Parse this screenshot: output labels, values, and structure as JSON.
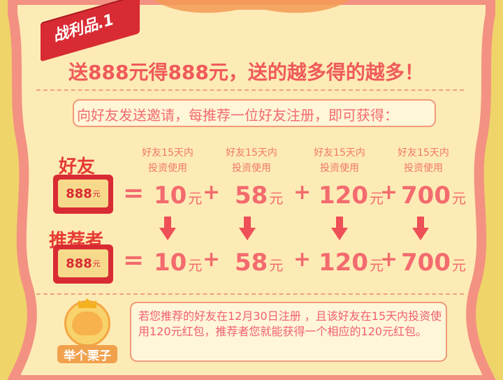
{
  "title_tag": "战利品.1",
  "headline": "送888元得888元，送的越多得的越多！",
  "invite_text": "向好友发送邀请，每推荐一位好友注册，即可获得：",
  "conditions": [
    {
      "line1": "好友15天内",
      "line2": "投资使用"
    },
    {
      "line1": "好友15天内",
      "line2": "投资使用"
    },
    {
      "line1": "好友15天内",
      "line2": "投资使用"
    },
    {
      "line1": "好友15天内",
      "line2": "投资使用"
    }
  ],
  "friend_row": {
    "label": "好友",
    "badge_value": "888",
    "badge_unit": "元",
    "equals": "=",
    "values": [
      {
        "value": "10",
        "unit": "元"
      },
      {
        "value": "58",
        "unit": "元"
      },
      {
        "value": "120",
        "unit": "元"
      },
      {
        "value": "700",
        "unit": "元"
      }
    ],
    "plus": "+"
  },
  "referrer_row": {
    "label": "推荐者",
    "badge_value": "888",
    "badge_unit": "元",
    "equals": "=",
    "values": [
      {
        "value": "10",
        "unit": "元"
      },
      {
        "value": "58",
        "unit": "元"
      },
      {
        "value": "120",
        "unit": "元"
      },
      {
        "value": "700",
        "unit": "元"
      }
    ],
    "plus": "+"
  },
  "example": {
    "label": "举个栗子",
    "text": "若您推荐的好友在12月30日注册 ，且该好友在15天内投资使用120元红包，推荐者您就能获得一个相应的120元红包。"
  },
  "icons": {
    "mascot": "chestnut-mascot-icon",
    "arrow": "down-arrow-icon"
  },
  "colors": {
    "background": "#efd46a",
    "panel": "#fdebb5",
    "border": "#f39182",
    "accent_red": "#d82b33",
    "text_red": "#f36b6e"
  }
}
